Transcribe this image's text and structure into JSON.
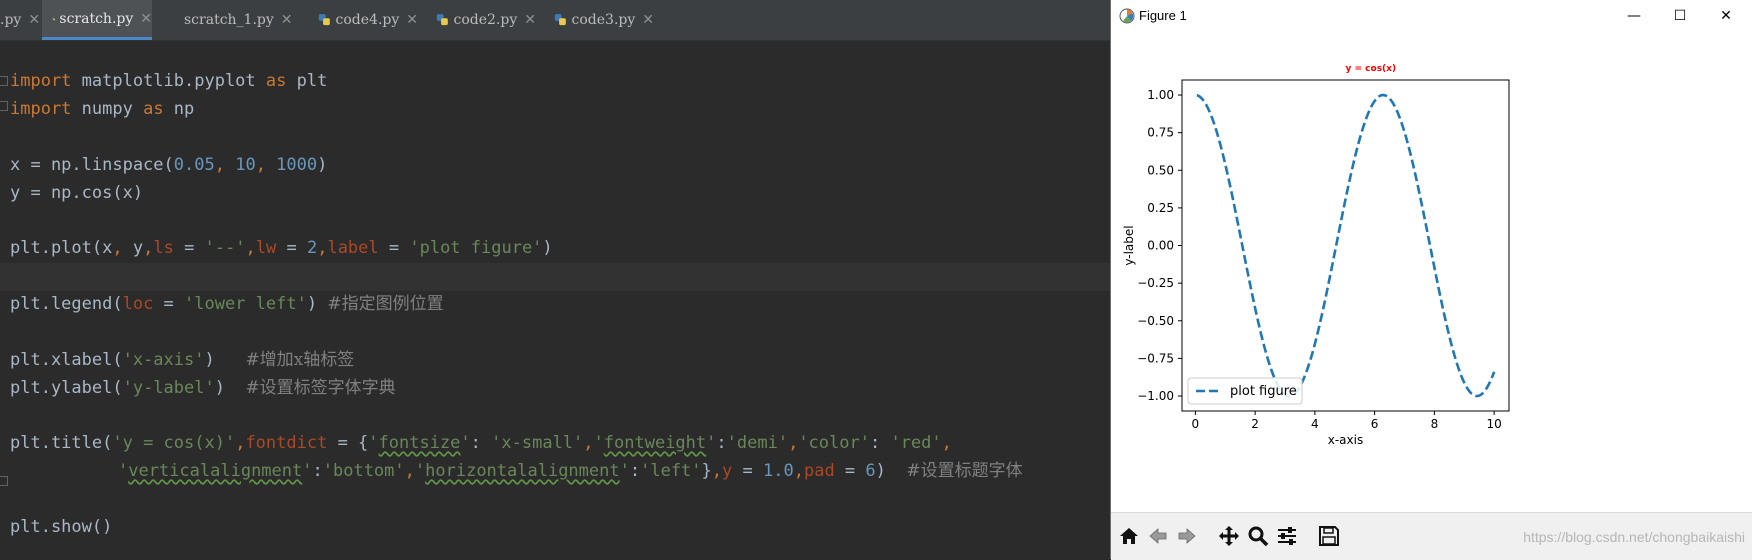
{
  "tabs": [
    {
      "label": ".py",
      "active": false
    },
    {
      "label": "scratch.py",
      "active": true
    },
    {
      "label": "scratch_1.py",
      "active": false
    },
    {
      "label": "code4.py",
      "active": false
    },
    {
      "label": "code2.py",
      "active": false
    },
    {
      "label": "code3.py",
      "active": false
    }
  ],
  "code": {
    "l1": {
      "kw1": "import",
      "t1": " matplotlib.pyplot ",
      "kw2": "as",
      "t2": " plt"
    },
    "l2": {
      "kw1": "import",
      "t1": " numpy ",
      "kw2": "as",
      "t2": " np"
    },
    "l3": {
      "t1": "x = np.linspace(",
      "n1": "0.05",
      "c1": ", ",
      "n2": "10",
      "c2": ", ",
      "n3": "1000",
      "t2": ")"
    },
    "l4": {
      "t1": "y = np.cos(x)"
    },
    "l5": {
      "t1": "plt.plot(x",
      "c1": ", ",
      "t2": "y",
      "c2": ",",
      "p1": "ls",
      "t3": " = ",
      "s1": "'--'",
      "c3": ",",
      "p2": "lw",
      "t4": " = ",
      "n1": "2",
      "c4": ",",
      "p3": "label",
      "t5": " = ",
      "s2": "'plot figure'",
      "t6": ")"
    },
    "l6": {
      "t1": "plt.legend(",
      "p1": "loc",
      "t2": " = ",
      "s1": "'lower left'",
      "t3": ") ",
      "cm": "#指定图例位置"
    },
    "l7": {
      "t1": "plt.xlabel(",
      "s1": "'x-axis'",
      "t2": ")   ",
      "cm": "#增加x轴标签"
    },
    "l8": {
      "t1": "plt.ylabel(",
      "s1": "'y-label'",
      "t2": ")  ",
      "cm": "#设置标签字体字典"
    },
    "l9": {
      "t1": "plt.title(",
      "s1": "'y = cos(x)'",
      "c1": ",",
      "p1": "fontdict",
      "t2": " = {",
      "s2a": "'",
      "s2b": "fontsize",
      "s2c": "'",
      "t3": ": ",
      "s3": "'x-small'",
      "c2": ",",
      "s4a": "'",
      "s4b": "fontweight",
      "s4c": "'",
      "t4": ":",
      "s5": "'demi'",
      "c3": ",",
      "s6": "'color'",
      "t5": ": ",
      "s7": "'red'",
      "c4": ","
    },
    "l10": {
      "s1a": "'",
      "s1b": "verticalalignment",
      "s1c": "'",
      "t1": ":",
      "s2": "'bottom'",
      "c1": ",",
      "s3a": "'",
      "s3b": "horizontalalignment",
      "s3c": "'",
      "t2": ":",
      "s4": "'left'",
      "t3": "}",
      "c2": ",",
      "p1": "y",
      "t4": " = ",
      "n1": "1.0",
      "c3": ",",
      "p2": "pad",
      "t5": " = ",
      "n2": "6",
      "t6": ")  ",
      "cm": "#设置标题字体"
    },
    "l11": {
      "t1": "plt.show()"
    }
  },
  "figure": {
    "window_title": "Figure 1",
    "minimize": "—",
    "maximize": "☐",
    "close": "✕",
    "watermark": "https://blog.csdn.net/chongbaikaishi"
  },
  "chart_data": {
    "type": "line",
    "title": "y = cos(x)",
    "title_color": "#ff0000",
    "xlabel": "x-axis",
    "ylabel": "y-label",
    "xlim": [
      -0.4475,
      10.4975
    ],
    "ylim": [
      -1.0995,
      1.0999
    ],
    "xticks": [
      "0",
      "2",
      "4",
      "6",
      "8",
      "10"
    ],
    "xtick_values": [
      0,
      2,
      4,
      6,
      8,
      10
    ],
    "yticks": [
      "1.00",
      "0.75",
      "0.50",
      "0.25",
      "0.00",
      "−0.25",
      "−0.50",
      "−0.75",
      "−1.00"
    ],
    "ytick_values": [
      1.0,
      0.75,
      0.5,
      0.25,
      0.0,
      -0.25,
      -0.5,
      -0.75,
      -1.0
    ],
    "series": [
      {
        "name": "plot figure",
        "function": "cos",
        "x_start": 0.05,
        "x_end": 10,
        "n_points": 1000,
        "color": "#1f77b4",
        "linestyle": "dashed"
      }
    ],
    "legend": "lower left"
  }
}
